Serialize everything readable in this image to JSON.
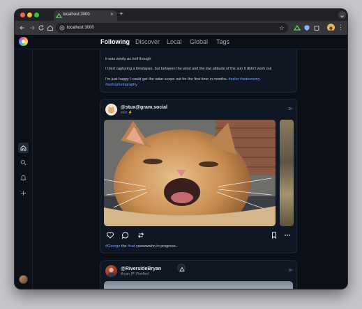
{
  "browser": {
    "tab_title": "localhost:3000",
    "new_tab_symbol": "+",
    "close_symbol": "×",
    "url": "localhost:3000"
  },
  "nav": {
    "tabs": [
      {
        "label": "Following",
        "active": true
      },
      {
        "label": "Discover",
        "active": false
      },
      {
        "label": "Local",
        "active": false
      },
      {
        "label": "Global",
        "active": false
      },
      {
        "label": "Tags",
        "active": false
      }
    ]
  },
  "sidebar": {
    "icons": [
      "home-icon",
      "search-icon",
      "bell-icon",
      "plus-icon"
    ]
  },
  "posts": [
    {
      "lines": [
        {
          "text": "it was windy as hell though"
        },
        {
          "text": "I tried capturing a timelapse, but between the wind and the low altitude of the sun it didn't work out"
        },
        {
          "text": "I'm just happy I could get the solar scope out for the first time in months.",
          "tags": " #solar #astronomy"
        },
        {
          "tags": "#astrophotography"
        }
      ]
    },
    {
      "handle": "@stux@gram.social",
      "display_name": "stux ⚡️",
      "time": "2h",
      "caption_tag1": "#George",
      "caption_mid": " the ",
      "caption_tag2": "#cat",
      "caption_rest": " yawwwwhn in progress.."
    },
    {
      "handle": "@RiversideBryan",
      "display_name": "Bryan 🏴 Pixelfed",
      "time": "3h"
    }
  ],
  "colors": {
    "accent": "#7aa4ff",
    "background": "#0b1018",
    "card": "#0f1724"
  }
}
